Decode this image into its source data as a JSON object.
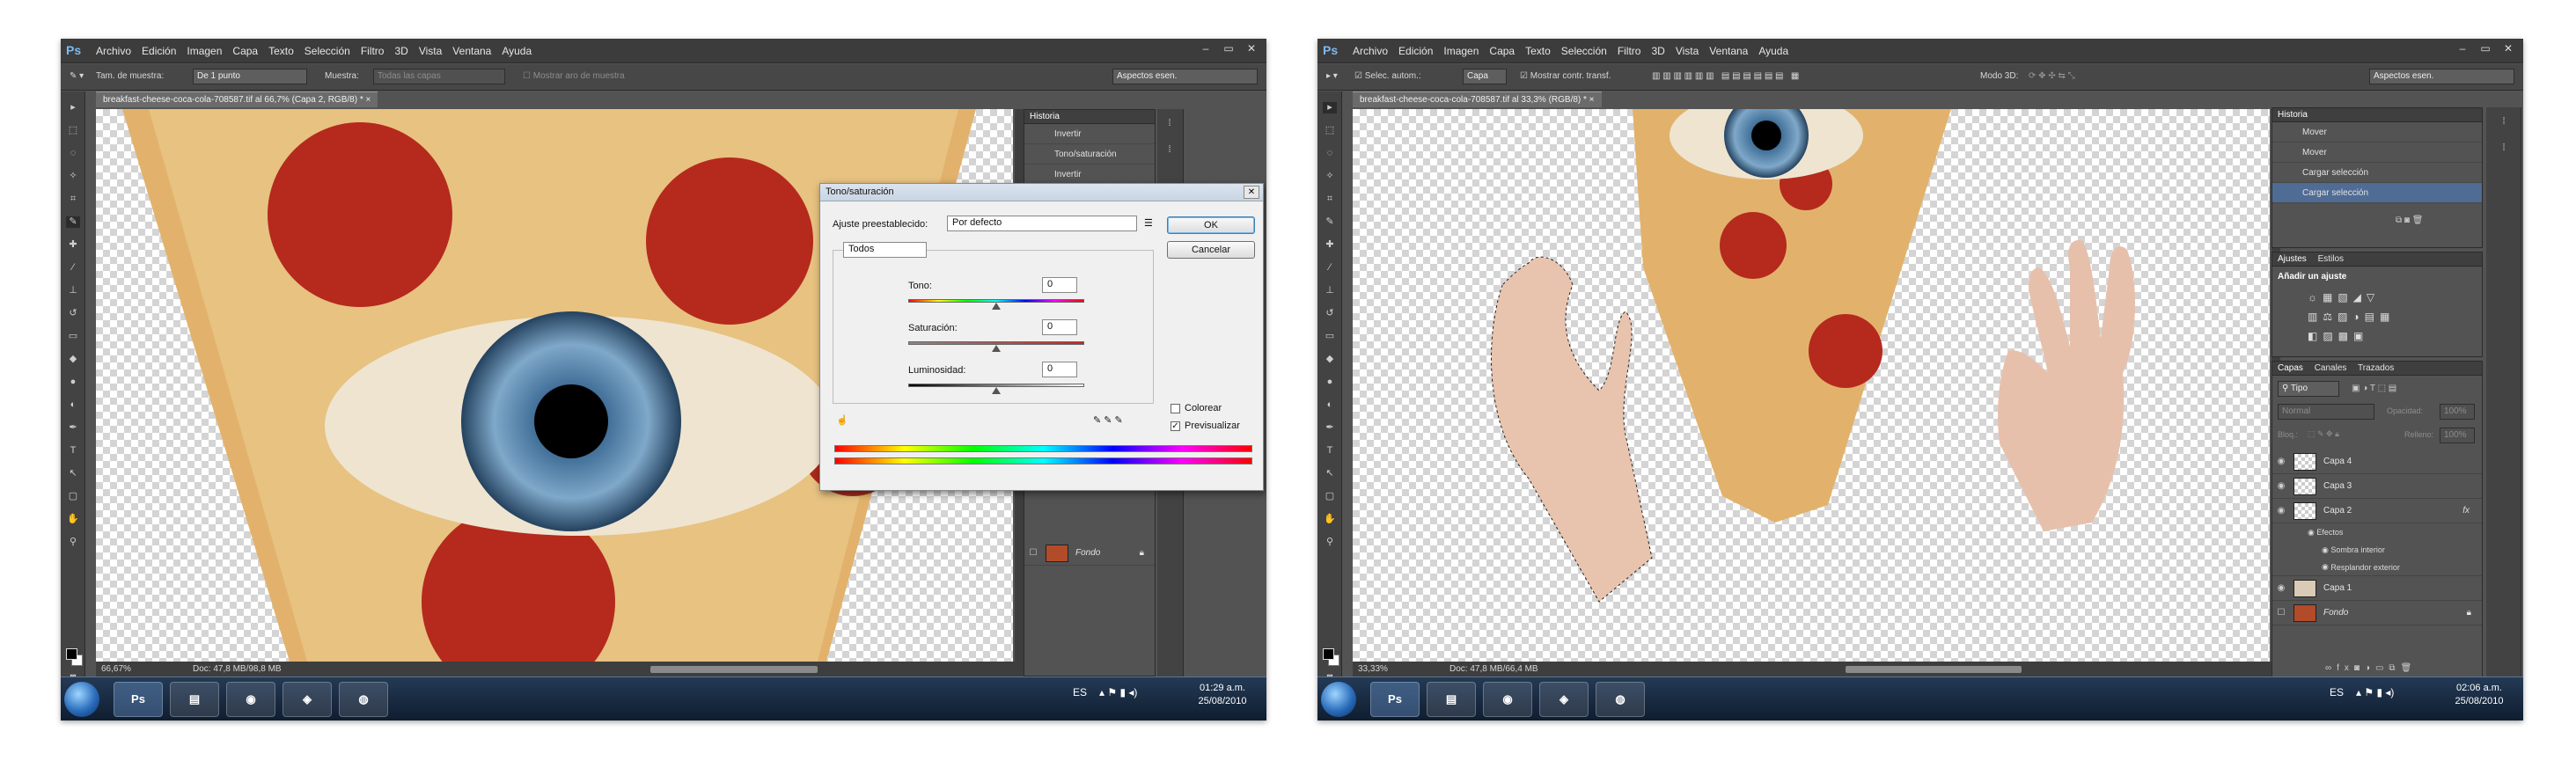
{
  "menu": [
    "Archivo",
    "Edición",
    "Imagen",
    "Capa",
    "Texto",
    "Selección",
    "Filtro",
    "3D",
    "Vista",
    "Ventana",
    "Ayuda"
  ],
  "app_logo": "Ps",
  "window_buttons": [
    "–",
    "▭",
    "✕"
  ],
  "left": {
    "options": {
      "sample_size_label": "Tam. de muestra:",
      "sample_size_value": "De 1 punto",
      "sample_label": "Muestra:",
      "sample_value": "Todas las capas",
      "show_ring": "Mostrar aro de muestra",
      "workspace": "Aspectos esen."
    },
    "doc_tab": "breakfast-cheese-coca-cola-708587.tif al 66,7% (Capa 2, RGB/8) * ×",
    "zoom": "66,67%",
    "doc_info": "Doc: 47,8 MB/98,8 MB",
    "history": {
      "title": "Historia",
      "items": [
        "Invertir",
        "Tono/saturación",
        "Invertir"
      ]
    },
    "layer_fondo": "Fondo",
    "dialog": {
      "title": "Tono/saturación",
      "preset_label": "Ajuste preestablecido:",
      "preset_value": "Por defecto",
      "ok": "OK",
      "cancel": "Cancelar",
      "channel": "Todos",
      "hue_label": "Tono:",
      "hue_value": "0",
      "saturation_label": "Saturación:",
      "saturation_value": "0",
      "lightness_label": "Luminosidad:",
      "lightness_value": "0",
      "colorize_label": "Colorear",
      "colorize_checked": false,
      "preview_label": "Previsualizar",
      "preview_checked": true
    },
    "taskbar": {
      "lang": "ES",
      "time": "01:29 a.m.",
      "date": "25/08/2010"
    }
  },
  "right": {
    "options": {
      "auto_select": "Selec. autom.:",
      "auto_select_value": "Capa",
      "transform_controls": "Mostrar contr. transf.",
      "mode_3d": "Modo 3D:",
      "workspace": "Aspectos esen."
    },
    "doc_tab": "breakfast-cheese-coca-cola-708587.tif al 33,3% (RGB/8) * ×",
    "zoom": "33,33%",
    "doc_info": "Doc: 47,8 MB/66,4 MB",
    "history": {
      "title": "Historia",
      "items": [
        "Mover",
        "Mover",
        "Cargar selección",
        "Cargar selección"
      ],
      "selected_index": 3
    },
    "adjustments": {
      "tabs": [
        "Ajustes",
        "Estilos"
      ],
      "heading": "Añadir un ajuste"
    },
    "layers": {
      "tabs": [
        "Capas",
        "Canales",
        "Trazados"
      ],
      "kind_filter": "Tipo",
      "blend_mode": "Normal",
      "opacity_label": "Opacidad:",
      "opacity_value": "100%",
      "lock_label": "Bloq.:",
      "fill_label": "Relleno:",
      "fill_value": "100%",
      "rows": [
        {
          "name": "Capa 4",
          "fx": ""
        },
        {
          "name": "Capa 3",
          "fx": ""
        },
        {
          "name": "Capa 2",
          "fx": "fx"
        }
      ],
      "effects_label": "Efectos",
      "effects": [
        "Sombra interior",
        "Resplandor exterior"
      ],
      "capa1": "Capa 1",
      "fondo": "Fondo"
    },
    "taskbar": {
      "lang": "ES",
      "time": "02:06 a.m.",
      "date": "25/08/2010"
    }
  },
  "icons": {
    "ps_task": "Ps"
  },
  "colors": {
    "ui_dark": "#535353",
    "menubar": "#3c3c3c",
    "selection": "#4f6c94",
    "dialog_bg": "#f0f0f0"
  }
}
